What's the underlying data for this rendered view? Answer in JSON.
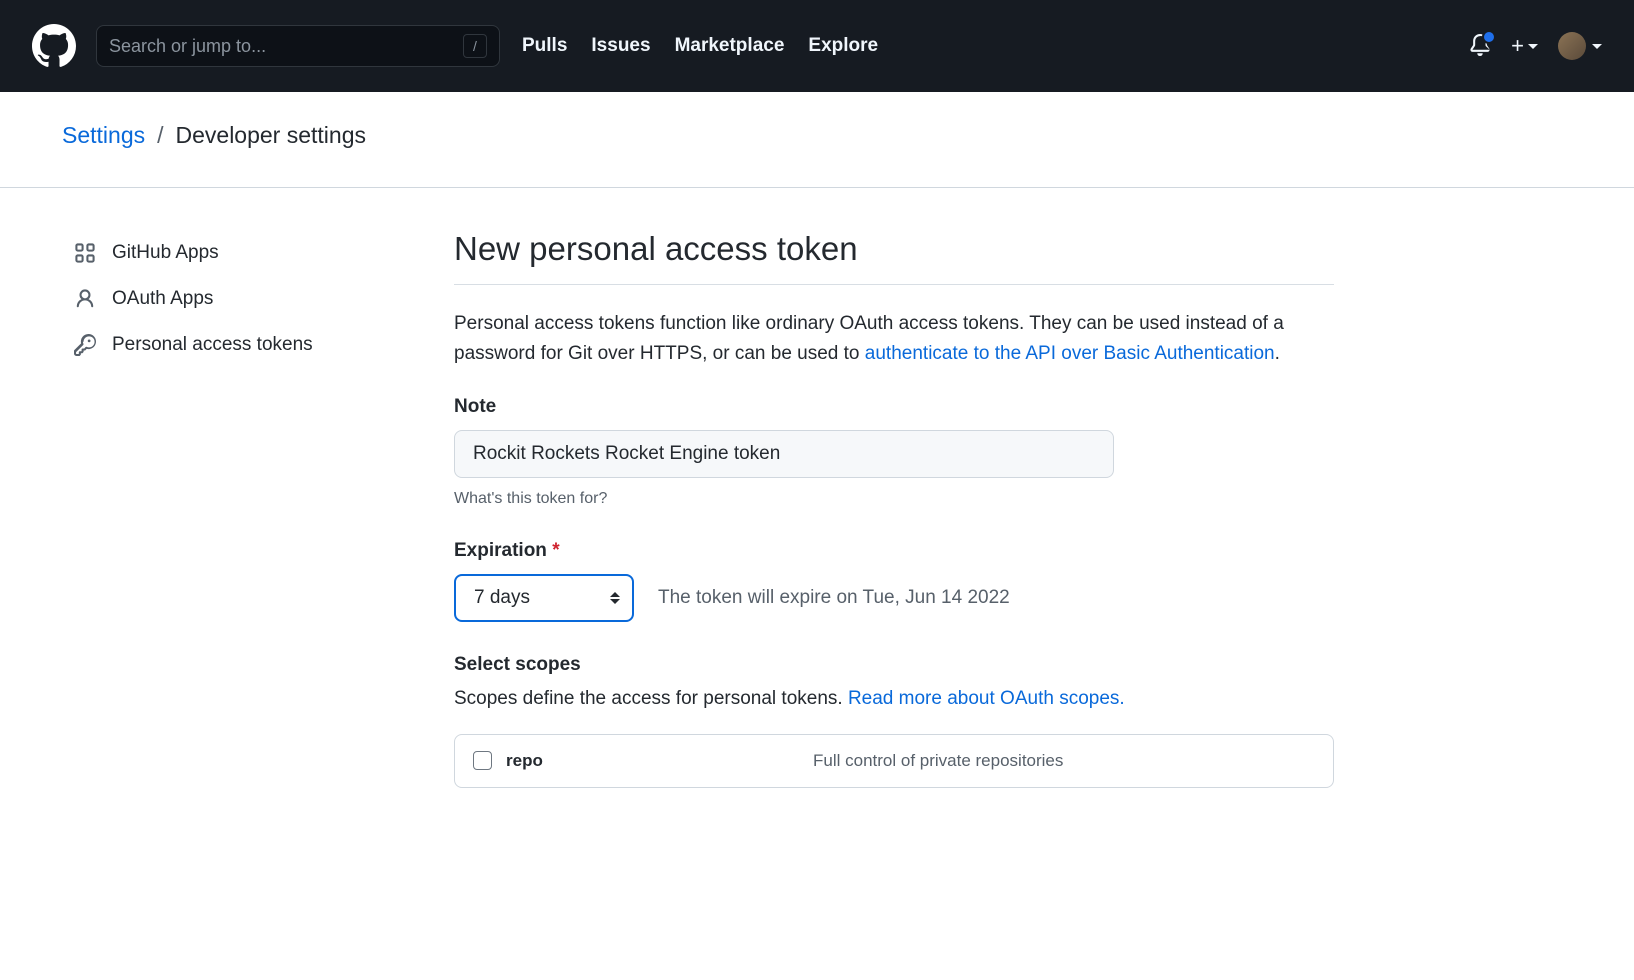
{
  "header": {
    "searchPlaceholder": "Search or jump to...",
    "slashKey": "/",
    "nav": {
      "pulls": "Pulls",
      "issues": "Issues",
      "marketplace": "Marketplace",
      "explore": "Explore"
    }
  },
  "breadcrumb": {
    "settings": "Settings",
    "separator": "/",
    "current": "Developer settings"
  },
  "sidebar": {
    "githubApps": "GitHub Apps",
    "oauthApps": "OAuth Apps",
    "tokens": "Personal access tokens"
  },
  "page": {
    "title": "New personal access token",
    "descPrefix": "Personal access tokens function like ordinary OAuth access tokens. They can be used instead of a password for Git over HTTPS, or can be used to ",
    "descLink": "authenticate to the API over Basic Authentication",
    "descSuffix": "."
  },
  "form": {
    "noteLabel": "Note",
    "noteValue": "Rockit Rockets Rocket Engine token",
    "noteHelp": "What's this token for?",
    "expirationLabel": "Expiration",
    "expirationValue": "7 days",
    "expirationText": "The token will expire on Tue, Jun 14 2022",
    "scopesLabel": "Select scopes",
    "scopesDescPrefix": "Scopes define the access for personal tokens. ",
    "scopesLink": "Read more about OAuth scopes."
  },
  "scopes": {
    "repo": {
      "name": "repo",
      "desc": "Full control of private repositories"
    }
  }
}
